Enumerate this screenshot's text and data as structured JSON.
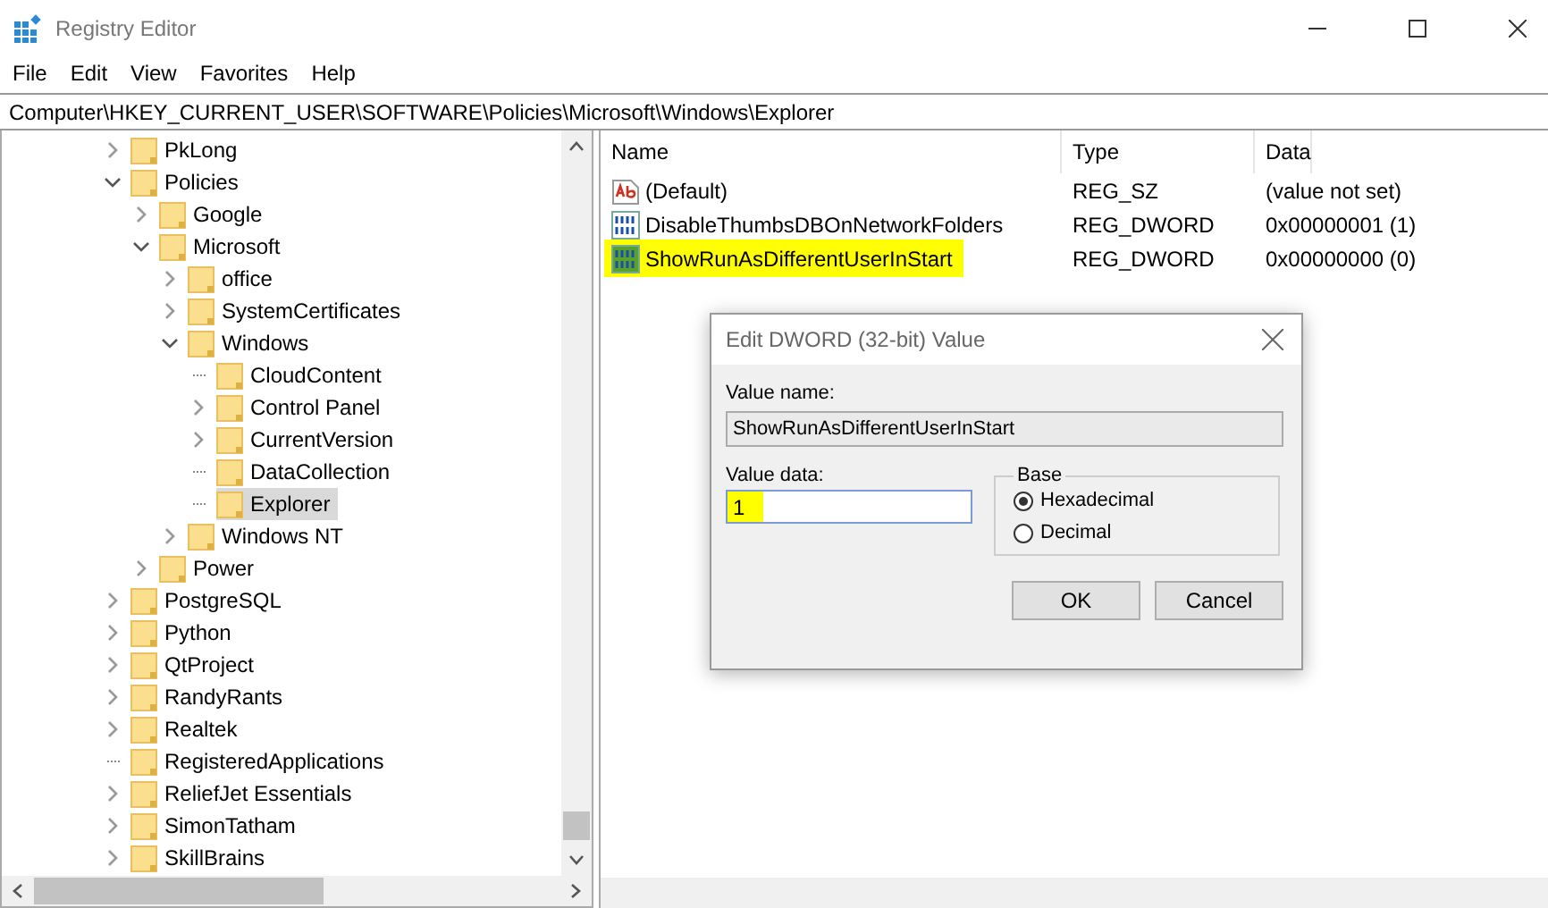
{
  "window": {
    "title": "Registry Editor"
  },
  "menu": [
    "File",
    "Edit",
    "View",
    "Favorites",
    "Help"
  ],
  "address": "Computer\\HKEY_CURRENT_USER\\SOFTWARE\\Policies\\Microsoft\\Windows\\Explorer",
  "tree": [
    {
      "label": "PkLong",
      "kind": "branch",
      "expanded": false,
      "selected": false
    },
    {
      "label": "Policies",
      "kind": "branch",
      "expanded": true,
      "selected": false,
      "children": [
        {
          "label": "Google",
          "kind": "branch",
          "expanded": false,
          "selected": false
        },
        {
          "label": "Microsoft",
          "kind": "branch",
          "expanded": true,
          "selected": false,
          "children": [
            {
              "label": "office",
              "kind": "branch",
              "expanded": false,
              "selected": false
            },
            {
              "label": "SystemCertificates",
              "kind": "branch",
              "expanded": false,
              "selected": false
            },
            {
              "label": "Windows",
              "kind": "branch",
              "expanded": true,
              "selected": false,
              "children": [
                {
                  "label": "CloudContent",
                  "kind": "leaf",
                  "selected": false
                },
                {
                  "label": "Control Panel",
                  "kind": "branch",
                  "expanded": false,
                  "selected": false
                },
                {
                  "label": "CurrentVersion",
                  "kind": "branch",
                  "expanded": false,
                  "selected": false
                },
                {
                  "label": "DataCollection",
                  "kind": "leaf",
                  "selected": false
                },
                {
                  "label": "Explorer",
                  "kind": "leaf",
                  "selected": true
                }
              ]
            },
            {
              "label": "Windows NT",
              "kind": "branch",
              "expanded": false,
              "selected": false
            }
          ]
        },
        {
          "label": "Power",
          "kind": "branch",
          "expanded": false,
          "selected": false
        }
      ]
    },
    {
      "label": "PostgreSQL",
      "kind": "branch",
      "expanded": false,
      "selected": false
    },
    {
      "label": "Python",
      "kind": "branch",
      "expanded": false,
      "selected": false
    },
    {
      "label": "QtProject",
      "kind": "branch",
      "expanded": false,
      "selected": false
    },
    {
      "label": "RandyRants",
      "kind": "branch",
      "expanded": false,
      "selected": false
    },
    {
      "label": "Realtek",
      "kind": "branch",
      "expanded": false,
      "selected": false
    },
    {
      "label": "RegisteredApplications",
      "kind": "leaf",
      "selected": false
    },
    {
      "label": "ReliefJet Essentials",
      "kind": "branch",
      "expanded": false,
      "selected": false
    },
    {
      "label": "SimonTatham",
      "kind": "branch",
      "expanded": false,
      "selected": false
    },
    {
      "label": "SkillBrains",
      "kind": "branch",
      "expanded": false,
      "selected": false
    }
  ],
  "values": {
    "columns": [
      "Name",
      "Type",
      "Data"
    ],
    "rows": [
      {
        "kind": "string",
        "name": "(Default)",
        "type": "REG_SZ",
        "data": "(value not set)",
        "selected": false,
        "highlighted": false
      },
      {
        "kind": "binary",
        "name": "DisableThumbsDBOnNetworkFolders",
        "type": "REG_DWORD",
        "data": "0x00000001 (1)",
        "selected": false,
        "highlighted": false
      },
      {
        "kind": "binary",
        "name": "ShowRunAsDifferentUserInStart",
        "type": "REG_DWORD",
        "data": "0x00000000 (0)",
        "selected": false,
        "highlighted": true
      }
    ]
  },
  "dialog": {
    "title": "Edit DWORD (32-bit) Value",
    "value_name_label": "Value name:",
    "value_name": "ShowRunAsDifferentUserInStart",
    "value_data_label": "Value data:",
    "value_data": "1",
    "value_data_highlighted": true,
    "base_label": "Base",
    "bases": [
      {
        "label": "Hexadecimal",
        "selected": true
      },
      {
        "label": "Decimal",
        "selected": false
      }
    ],
    "buttons": [
      "OK",
      "Cancel"
    ]
  }
}
